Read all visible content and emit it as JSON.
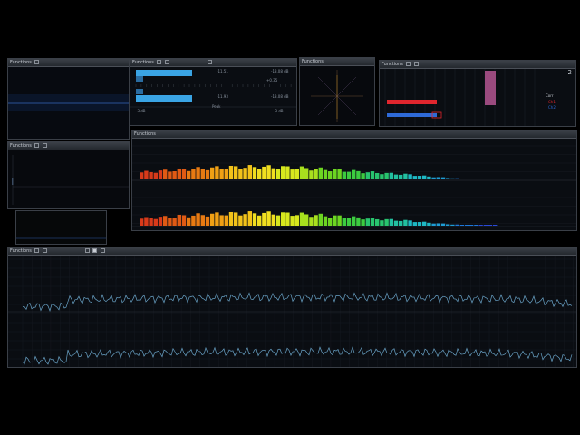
{
  "window_title": "Functions",
  "panels": {
    "scope": {
      "title": "Functions"
    },
    "peak": {
      "title": "Functions",
      "lane1_value": "-11.51",
      "lane1_max": "-13.08 dB",
      "lane1_sub": "+0.35",
      "lane2_value": "-11.93",
      "lane2_max": "-13.08 dB",
      "scale_left": "-3 dB",
      "scale_right": "-3 dB",
      "footer_label": "Peak"
    },
    "goniometer": {
      "title": "Functions"
    },
    "stereo": {
      "title": "Functions",
      "corner_badge": "2",
      "legend_1": "Corr",
      "legend_2": "Ch1",
      "legend_3": "Ch2",
      "accent_red": "#e0262e",
      "accent_pink": "#9a4a7e",
      "accent_blue": "#2e6ad8"
    },
    "small": {
      "title": "Functions"
    },
    "bands": {
      "title": "Functions"
    },
    "analyzer": {
      "title": "Functions"
    }
  },
  "band_colors": [
    "#d83a1a",
    "#e05a14",
    "#e87a12",
    "#f0a014",
    "#f2c21a",
    "#f0de20",
    "#d8e81e",
    "#a8e01e",
    "#6cd622",
    "#3ccc40",
    "#28c46e",
    "#22c0a0",
    "#1eb8c4",
    "#1e9cd4",
    "#1e78dc",
    "#2a4ad8"
  ],
  "colors": {
    "panel_bg": "#0b0e13",
    "border": "#3a3f47",
    "spectrum_line": "#6aa4c8"
  }
}
